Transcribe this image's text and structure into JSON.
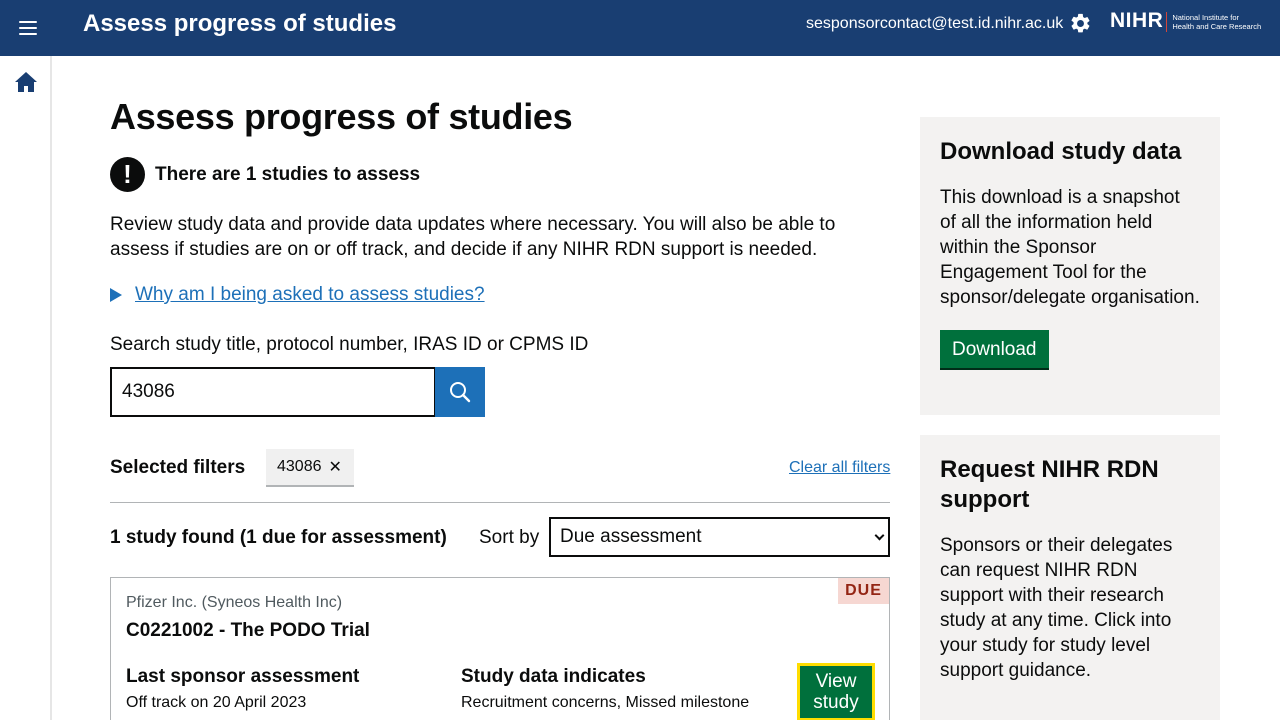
{
  "header": {
    "title": "Assess progress of studies",
    "user_email": "sesponsorcontact@test.id.nihr.ac.uk",
    "logo": {
      "mark": "NIHR",
      "line1": "National Institute for",
      "line2": "Health and Care Research"
    }
  },
  "sidenav": {
    "items": [
      {
        "icon": "home-icon"
      }
    ]
  },
  "main": {
    "page_title": "Assess progress of studies",
    "alert": "There are 1 studies to assess",
    "intro": "Review study data and provide data updates where necessary. You will also be able to assess if studies are on or off track, and decide if any NIHR RDN support is needed.",
    "details_summary": "Why am I being asked to assess studies?",
    "search": {
      "label": "Search study title, protocol number, IRAS ID or CPMS ID",
      "value": "43086"
    },
    "filters": {
      "label": "Selected filters",
      "chips": [
        "43086"
      ],
      "clear_label": "Clear all filters"
    },
    "results": {
      "count_text": "1 study found (1 due for assessment)",
      "sort_label": "Sort by",
      "sort_value": "Due assessment"
    },
    "study": {
      "tag": "DUE",
      "organisation": "Pfizer Inc. (Syneos Health Inc)",
      "title": "C0221002 - The PODO Trial",
      "last_assessment_heading": "Last sponsor assessment",
      "last_assessment_value": "Off track on 20 April 2023",
      "data_indicates_heading": "Study data indicates",
      "data_indicates_value": "Recruitment concerns, Missed milestone",
      "view_button": "View study"
    }
  },
  "aside": {
    "download": {
      "heading": "Download study data",
      "body": "This download is a snapshot of all the information held within the Sponsor Engagement Tool for the sponsor/delegate organisation.",
      "button": "Download"
    },
    "support": {
      "heading": "Request NIHR RDN support",
      "body": "Sponsors or their delegates can request NIHR RDN support with their research study at any time. Click into your study for study level support guidance."
    }
  },
  "colors": {
    "header_bg": "#193e72",
    "link": "#1d70b8",
    "button_green": "#00703c",
    "focus_yellow": "#ffdd00",
    "due_tag_bg": "#f6d7d2",
    "due_tag_text": "#942514",
    "panel_bg": "#f3f2f1"
  }
}
